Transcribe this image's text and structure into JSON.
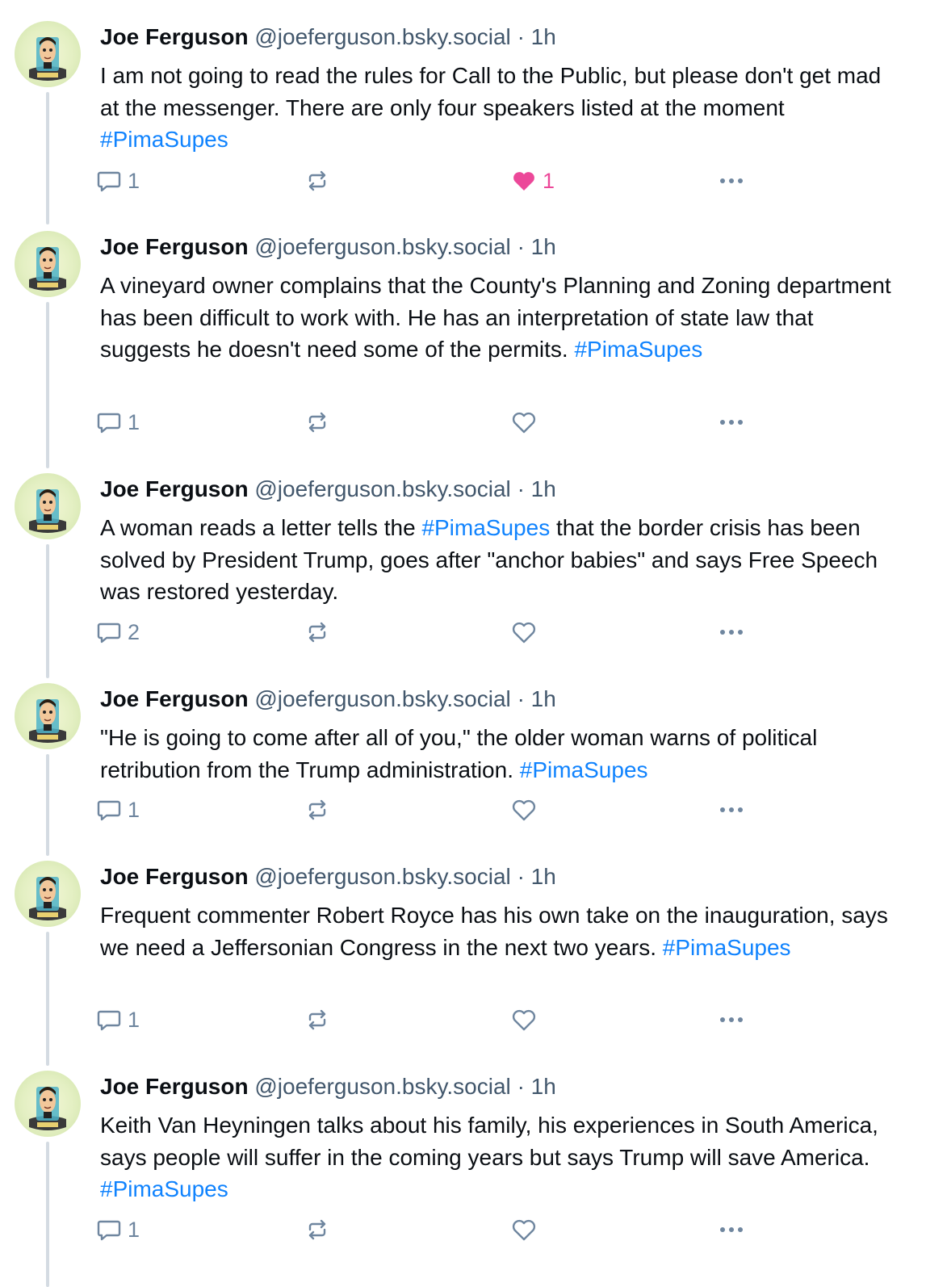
{
  "colors": {
    "link": "#1083fe",
    "muted": "#42576c",
    "icon": "#6f869f",
    "like_active": "#ec4899",
    "thread_line": "#d4dbe2"
  },
  "icons": {
    "reply": "speech-bubble-icon",
    "repost": "repost-arrows-icon",
    "like": "heart-icon",
    "more": "ellipsis-icon"
  },
  "posts": [
    {
      "author": "Joe Ferguson",
      "handle": "@joeferguson.bsky.social",
      "sep": "·",
      "time": "1h",
      "text_before": "I am not going to read the rules for Call to the Public, but please don't get mad at the messenger. There are only four speakers listed at the moment ",
      "hashtag": "#PimaSupes",
      "text_after": "",
      "replies": "1",
      "reposts": "",
      "likes": "1",
      "liked": true
    },
    {
      "author": "Joe Ferguson",
      "handle": "@joeferguson.bsky.social",
      "sep": "·",
      "time": "1h",
      "text_before": "A vineyard owner complains that the County's Planning and Zoning department has been difficult to work with. He has an interpretation of state law that suggests he doesn't need some of the permits. ",
      "hashtag": "#PimaSupes",
      "text_after": "",
      "replies": "1",
      "reposts": "",
      "likes": "",
      "liked": false
    },
    {
      "author": "Joe Ferguson",
      "handle": "@joeferguson.bsky.social",
      "sep": "·",
      "time": "1h",
      "text_before": "A woman reads a letter tells the ",
      "hashtag": "#PimaSupes",
      "text_after": " that the border crisis has been solved by President Trump, goes after \"anchor babies\" and says Free Speech was restored yesterday.",
      "replies": "2",
      "reposts": "",
      "likes": "",
      "liked": false
    },
    {
      "author": "Joe Ferguson",
      "handle": "@joeferguson.bsky.social",
      "sep": "·",
      "time": "1h",
      "text_before": "\"He is going to come after all of you,\" the older woman warns of political retribution from the Trump administration. ",
      "hashtag": "#PimaSupes",
      "text_after": "",
      "replies": "1",
      "reposts": "",
      "likes": "",
      "liked": false
    },
    {
      "author": "Joe Ferguson",
      "handle": "@joeferguson.bsky.social",
      "sep": "·",
      "time": "1h",
      "text_before": "Frequent commenter Robert Royce has his own take on the inauguration, says we need a Jeffersonian Congress in the next two years. ",
      "hashtag": "#PimaSupes",
      "text_after": "",
      "replies": "1",
      "reposts": "",
      "likes": "",
      "liked": false
    },
    {
      "author": "Joe Ferguson",
      "handle": "@joeferguson.bsky.social",
      "sep": "·",
      "time": "1h",
      "text_before": "Keith Van Heyningen talks about his family, his experiences in South America, says people will suffer in the coming years but says Trump will save America. ",
      "hashtag": "#PimaSupes",
      "text_after": "",
      "replies": "1",
      "reposts": "",
      "likes": "",
      "liked": false
    }
  ]
}
